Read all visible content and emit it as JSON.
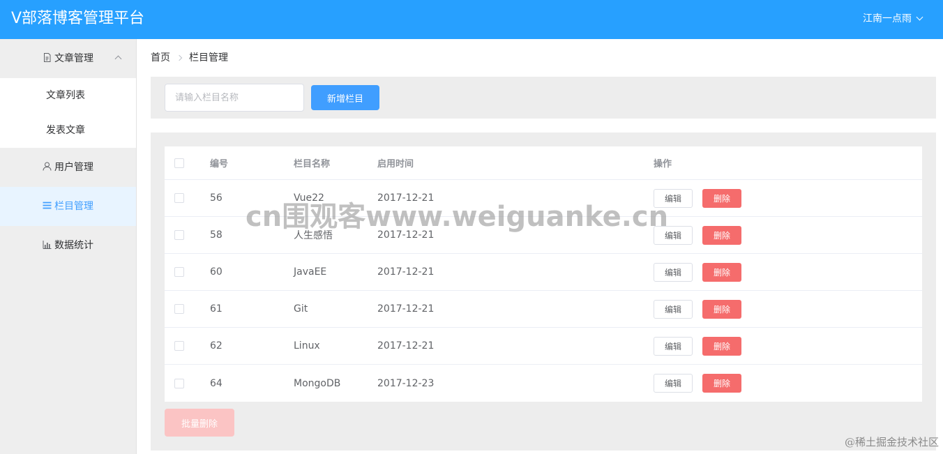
{
  "header": {
    "app_title": "V部落博客管理平台",
    "user_name": "江南一点雨"
  },
  "sidebar": {
    "groups": [
      {
        "label": "文章管理",
        "icon": "document-icon",
        "expanded": true,
        "children": [
          {
            "label": "文章列表"
          },
          {
            "label": "发表文章"
          }
        ]
      },
      {
        "label": "用户管理",
        "icon": "user-icon"
      },
      {
        "label": "栏目管理",
        "icon": "list-icon",
        "active": true
      },
      {
        "label": "数据统计",
        "icon": "bar-chart-icon"
      }
    ]
  },
  "breadcrumb": {
    "home": "首页",
    "current": "栏目管理"
  },
  "toolbar": {
    "search_placeholder": "请输入栏目名称",
    "add_label": "新增栏目"
  },
  "table": {
    "columns": {
      "id": "编号",
      "name": "栏目名称",
      "date": "启用时间",
      "ops": "操作"
    },
    "rows": [
      {
        "id": "56",
        "name": "Vue22",
        "date": "2017-12-21"
      },
      {
        "id": "58",
        "name": "人生感悟",
        "date": "2017-12-21"
      },
      {
        "id": "60",
        "name": "JavaEE",
        "date": "2017-12-21"
      },
      {
        "id": "61",
        "name": "Git",
        "date": "2017-12-21"
      },
      {
        "id": "62",
        "name": "Linux",
        "date": "2017-12-21"
      },
      {
        "id": "64",
        "name": "MongoDB",
        "date": "2017-12-23"
      }
    ],
    "edit_label": "编辑",
    "delete_label": "删除"
  },
  "batch_delete_label": "批量删除",
  "watermark": "cn围观客www.weiguanke.cn",
  "corner_mark": "@稀土掘金技术社区",
  "colors": {
    "header": "#27a0ff",
    "primary": "#409eff",
    "danger": "#f56c6c",
    "danger_disabled": "#fbc4c4"
  }
}
